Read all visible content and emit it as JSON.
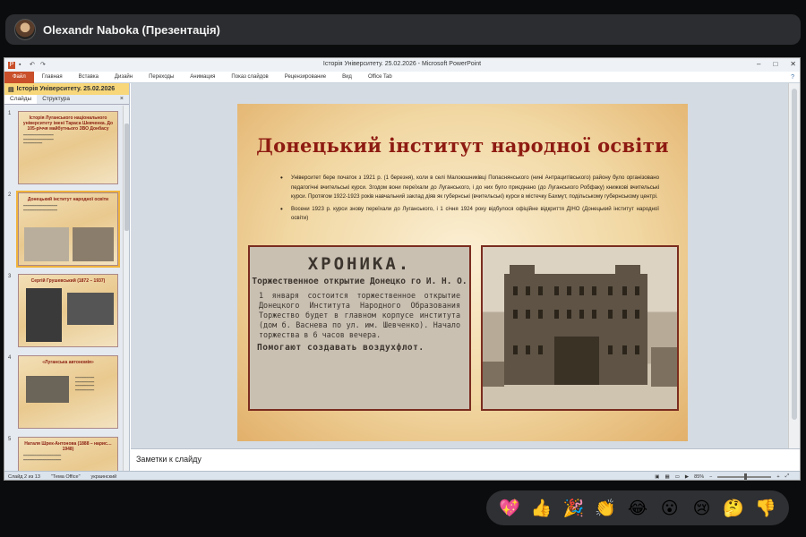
{
  "meeting": {
    "presenter": "Olexandr Naboka (Презентація)"
  },
  "window": {
    "title": "Історія Університету. 25.02.2026 - Microsoft PowerPoint",
    "controls": [
      "–",
      "□",
      "✕"
    ]
  },
  "ribbon": {
    "file_label": "Файл",
    "tabs": [
      "Главная",
      "Вставка",
      "Дизайн",
      "Переходы",
      "Анимация",
      "Показ слайдов",
      "Рецензирование",
      "Вид",
      "Office Tab"
    ]
  },
  "left_pane": {
    "presentation_tab": "Історія Університету. 25.02.2026",
    "tabs": [
      "Слайды",
      "Структура"
    ],
    "close": "×",
    "thumbnails": [
      {
        "num": "1",
        "title": "Історія Луганського національного університету імені Тараса Шевченка. До 105-річчя майбутнього ЗВО Донбасу"
      },
      {
        "num": "2",
        "title": "Донецький інститут народної освіти"
      },
      {
        "num": "3",
        "title": "Сергій Грушевський (1872 – 1937)"
      },
      {
        "num": "4",
        "title": "«Луганська автономія»"
      },
      {
        "num": "5",
        "title": "Наталя Шрек-Антонова (1888 – нарис… 1948)"
      }
    ]
  },
  "slide": {
    "title": "Донецький інститут народної освіти",
    "bullets": [
      "Університет бере початок з 1921 р. (1 березня), коли в селі Малоюшниківці Попаснянського (нині Антрацитівського) району було організовано педагогічні вчительські курси. Згодом вони переїхали до Луганського, і до них було приєднано (до Луганського Робфаку) книжкові вчительські курси. Протягом 1922-1923 років навчальний заклад діяв як губернські (вчительські) курси в містечку Бахмут, подільському губернському центрі.",
      "Восени 1923 р. курси знову переїхали до Луганського, і 1 січня 1924 року відбулося офіційне відкриття ДІНО (Донецький інститут народної освіти)"
    ],
    "newspaper": {
      "heading": "ХРОНИКА.",
      "subheading": "Торжественное открытие Донецко го И. Н. О.",
      "body": "1 января состоится торжественное открытие Донецкого Института Народного Образования Торжество будет в главном корпусе института (дом б. Васнева по ул. им. Шевченко). Начало торжества в 6 часов вечера.",
      "footer": "Помогают создавать воздухфлот."
    }
  },
  "notes": {
    "placeholder": "Заметки к слайду"
  },
  "status": {
    "slide_info": "Слайд 2 из 13",
    "theme": "\"Тема Office\"",
    "language": "украинский",
    "zoom": "85%"
  },
  "reactions": [
    "💖",
    "👍",
    "🎉",
    "👏",
    "😂",
    "😮",
    "😢",
    "🤔",
    "👎"
  ]
}
